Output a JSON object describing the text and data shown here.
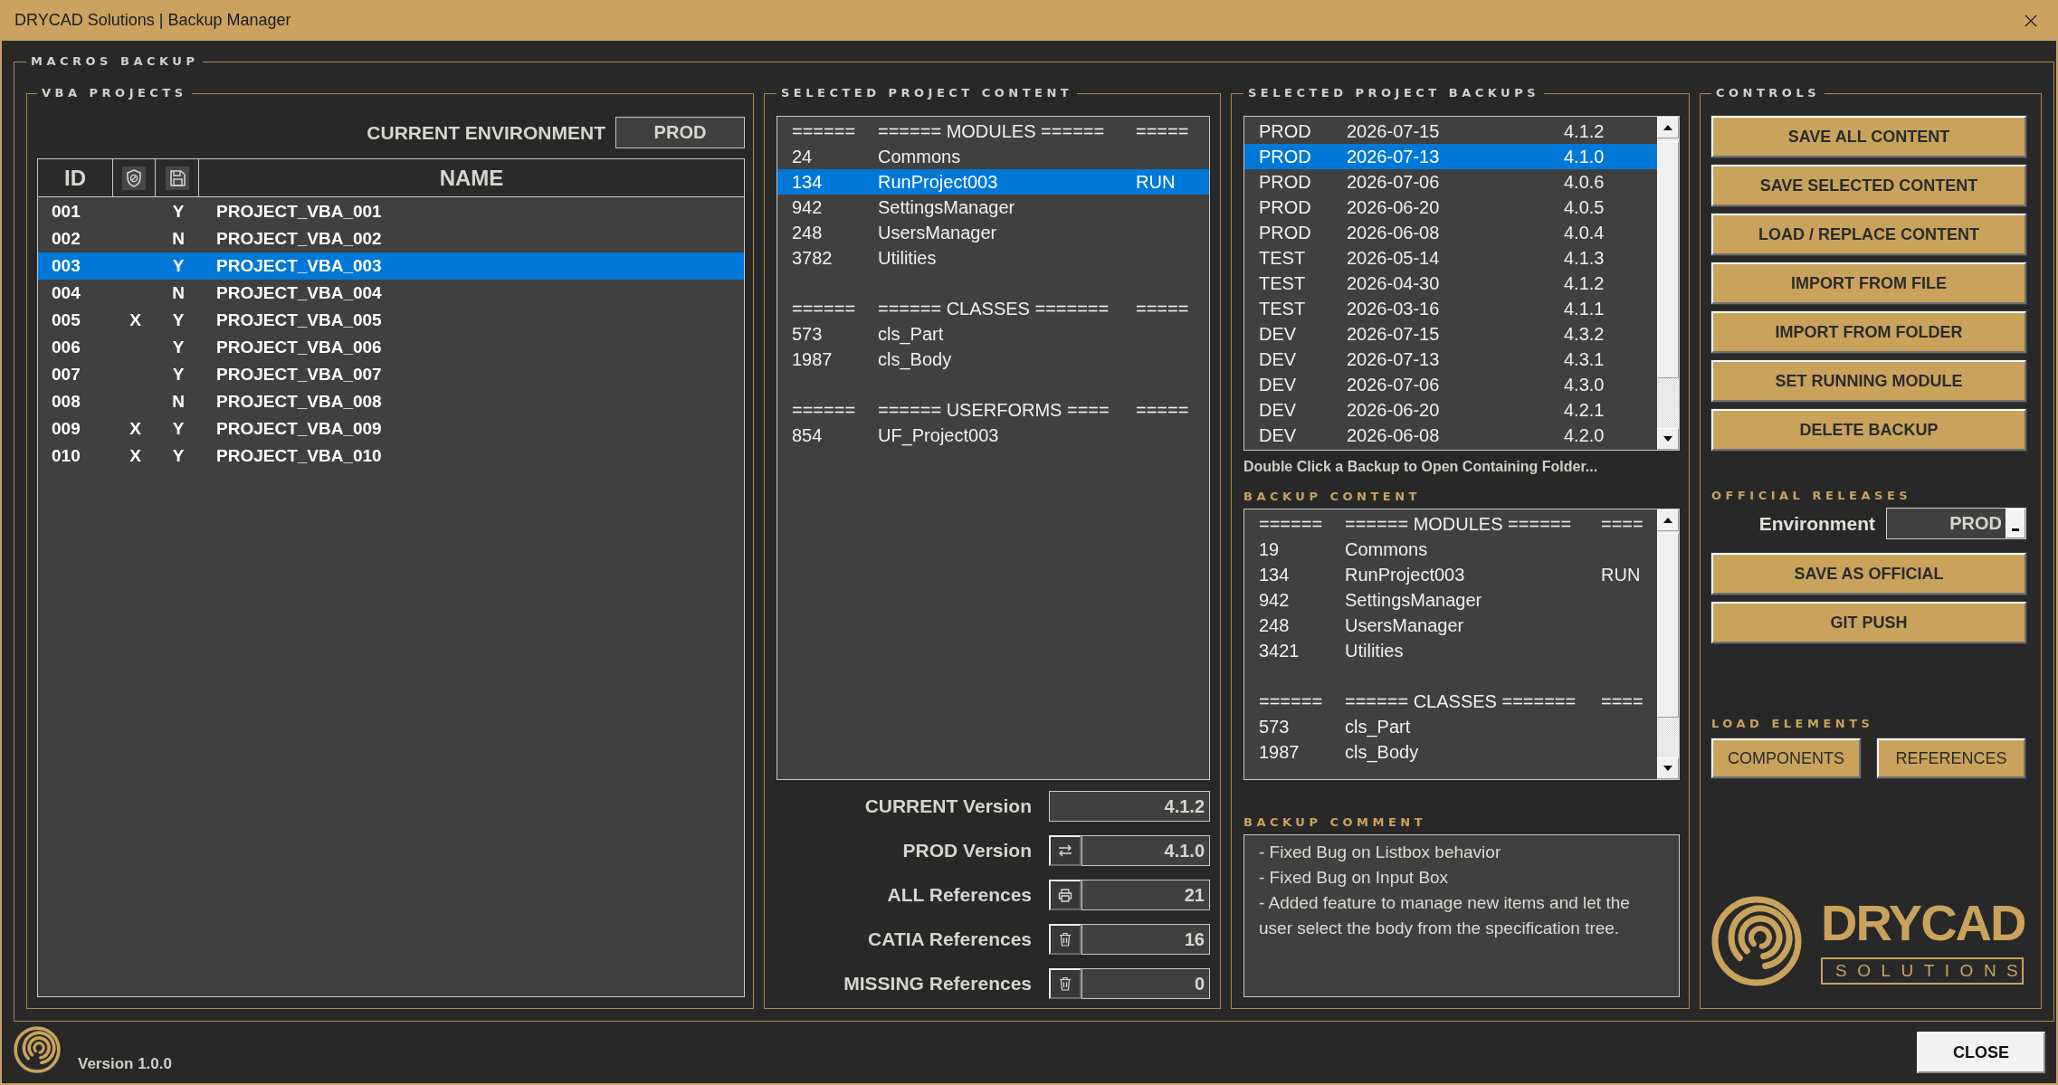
{
  "window": {
    "title": "DRYCAD Solutions | Backup Manager"
  },
  "macros_backup": {
    "title": "MACROS BACKUP",
    "vba_projects": {
      "title": "VBA PROJECTS",
      "environment_label": "CURRENT ENVIRONMENT",
      "environment_value": "PROD",
      "columns": {
        "id": "ID",
        "name": "NAME"
      },
      "rows": [
        {
          "id": "001",
          "column_3": "Y",
          "name": "PROJECT_VBA_001",
          "selected": false
        },
        {
          "id": "002",
          "column_3": "N",
          "name": "PROJECT_VBA_002",
          "selected": false
        },
        {
          "id": "003",
          "column_3": "Y",
          "name": "PROJECT_VBA_003",
          "selected": true
        },
        {
          "id": "004",
          "column_3": "N",
          "name": "PROJECT_VBA_004",
          "selected": false
        },
        {
          "id": "005",
          "column_2": "X",
          "column_3": "Y",
          "name": "PROJECT_VBA_005",
          "selected": false
        },
        {
          "id": "006",
          "column_3": "Y",
          "name": "PROJECT_VBA_006",
          "selected": false
        },
        {
          "id": "007",
          "column_3": "Y",
          "name": "PROJECT_VBA_007",
          "selected": false
        },
        {
          "id": "008",
          "column_3": "N",
          "name": "PROJECT_VBA_008",
          "selected": false
        },
        {
          "id": "009",
          "column_2": "X",
          "column_3": "Y",
          "name": "PROJECT_VBA_009",
          "selected": false
        },
        {
          "id": "010",
          "column_2": "X",
          "column_3": "Y",
          "name": "PROJECT_VBA_010",
          "selected": false
        }
      ]
    },
    "project_content": {
      "title": "SELECTED PROJECT CONTENT",
      "rows": [
        {
          "kind": "row",
          "cells": [
            "======",
            "====== MODULES ======",
            "====="
          ],
          "selected": false
        },
        {
          "kind": "row",
          "cells": [
            "24",
            "Commons"
          ],
          "selected": false
        },
        {
          "kind": "row",
          "cells": [
            "134",
            "RunProject003",
            "RUN"
          ],
          "selected": true
        },
        {
          "kind": "row",
          "cells": [
            "942",
            "SettingsManager"
          ],
          "selected": false
        },
        {
          "kind": "row",
          "cells": [
            "248",
            "UsersManager"
          ],
          "selected": false
        },
        {
          "kind": "row",
          "cells": [
            "3782",
            "Utilities"
          ],
          "selected": false
        },
        {
          "kind": "spacer"
        },
        {
          "kind": "row",
          "cells": [
            "======",
            "====== CLASSES =======",
            "====="
          ],
          "selected": false
        },
        {
          "kind": "row",
          "cells": [
            "573",
            "cls_Part"
          ],
          "selected": false
        },
        {
          "kind": "row",
          "cells": [
            "1987",
            "cls_Body"
          ],
          "selected": false
        },
        {
          "kind": "spacer"
        },
        {
          "kind": "row",
          "cells": [
            "======",
            "====== USERFORMS ====",
            "====="
          ],
          "selected": false
        },
        {
          "kind": "row",
          "cells": [
            "854",
            "UF_Project003"
          ],
          "selected": false
        }
      ],
      "fields": [
        {
          "kind": "plain",
          "label": "CURRENT Version",
          "value": "4.1.2"
        },
        {
          "kind": "action",
          "label": "PROD Version",
          "value": "4.1.0"
        },
        {
          "kind": "action",
          "label": "ALL References",
          "value": "21"
        },
        {
          "kind": "action",
          "label": "CATIA References",
          "value": "16"
        },
        {
          "kind": "action",
          "label": "MISSING References",
          "value": "0"
        }
      ]
    },
    "project_backups": {
      "title": "SELECTED PROJECT BACKUPS",
      "rows": [
        {
          "environment": "PROD",
          "date": "2026-07-15",
          "version": "4.1.2",
          "selected": false
        },
        {
          "environment": "PROD",
          "date": "2026-07-13",
          "version": "4.1.0",
          "selected": true
        },
        {
          "environment": "PROD",
          "date": "2026-07-06",
          "version": "4.0.6",
          "selected": false
        },
        {
          "environment": "PROD",
          "date": "2026-06-20",
          "version": "4.0.5",
          "selected": false
        },
        {
          "environment": "PROD",
          "date": "2026-06-08",
          "version": "4.0.4",
          "selected": false
        },
        {
          "environment": "TEST",
          "date": "2026-05-14",
          "version": "4.1.3",
          "selected": false
        },
        {
          "environment": "TEST",
          "date": "2026-04-30",
          "version": "4.1.2",
          "selected": false
        },
        {
          "environment": "TEST",
          "date": "2026-03-16",
          "version": "4.1.1",
          "selected": false
        },
        {
          "environment": "DEV",
          "date": "2026-07-15",
          "version": "4.3.2",
          "selected": false
        },
        {
          "environment": "DEV",
          "date": "2026-07-13",
          "version": "4.3.1",
          "selected": false
        },
        {
          "environment": "DEV",
          "date": "2026-07-06",
          "version": "4.3.0",
          "selected": false
        },
        {
          "environment": "DEV",
          "date": "2026-06-20",
          "version": "4.2.1",
          "selected": false
        },
        {
          "environment": "DEV",
          "date": "2026-06-08",
          "version": "4.2.0",
          "selected": false
        }
      ],
      "hint": "Double Click a Backup to Open Containing Folder...",
      "backup_content": {
        "title": "BACKUP CONTENT",
        "rows": [
          {
            "kind": "row",
            "cells": [
              "======",
              "====== MODULES ======",
              "===="
            ],
            "selected": false
          },
          {
            "kind": "row",
            "cells": [
              "19",
              "Commons"
            ],
            "selected": false
          },
          {
            "kind": "row",
            "cells": [
              "134",
              "RunProject003",
              "RUN"
            ],
            "selected": false
          },
          {
            "kind": "row",
            "cells": [
              "942",
              "SettingsManager"
            ],
            "selected": false
          },
          {
            "kind": "row",
            "cells": [
              "248",
              "UsersManager"
            ],
            "selected": false
          },
          {
            "kind": "row",
            "cells": [
              "3421",
              "Utilities"
            ],
            "selected": false
          },
          {
            "kind": "spacer"
          },
          {
            "kind": "row",
            "cells": [
              "======",
              "====== CLASSES =======",
              "===="
            ],
            "selected": false
          },
          {
            "kind": "row",
            "cells": [
              "573",
              "cls_Part"
            ],
            "selected": false
          },
          {
            "kind": "row",
            "cells": [
              "1987",
              "cls_Body"
            ],
            "selected": false
          }
        ]
      },
      "backup_comment": {
        "title": "BACKUP COMMENT",
        "lines": [
          "- Fixed Bug on Listbox behavior",
          "- Fixed Bug on Input Box",
          "- Added feature to manage new items and let the user select the body from the specification tree."
        ]
      }
    },
    "controls": {
      "title": "CONTROLS",
      "buttons": [
        "SAVE ALL CONTENT",
        "SAVE SELECTED CONTENT",
        "LOAD / REPLACE CONTENT",
        "IMPORT FROM FILE",
        "IMPORT FROM FOLDER",
        "SET RUNNING MODULE",
        "DELETE BACKUP"
      ],
      "official_releases": {
        "title": "OFFICIAL RELEASES",
        "environment_label": "Environment",
        "environment_value": "PROD",
        "buttons": [
          "SAVE AS OFFICIAL",
          "GIT PUSH"
        ]
      },
      "load_elements": {
        "title": "LOAD ELEMENTS",
        "buttons": [
          "COMPONENTS",
          "REFERENCES"
        ]
      },
      "logo": {
        "wordmark": "DRYCAD",
        "tagline": "SOLUTIONS"
      }
    }
  },
  "footer": {
    "version": "Version 1.0.0",
    "close_button": "CLOSE"
  }
}
